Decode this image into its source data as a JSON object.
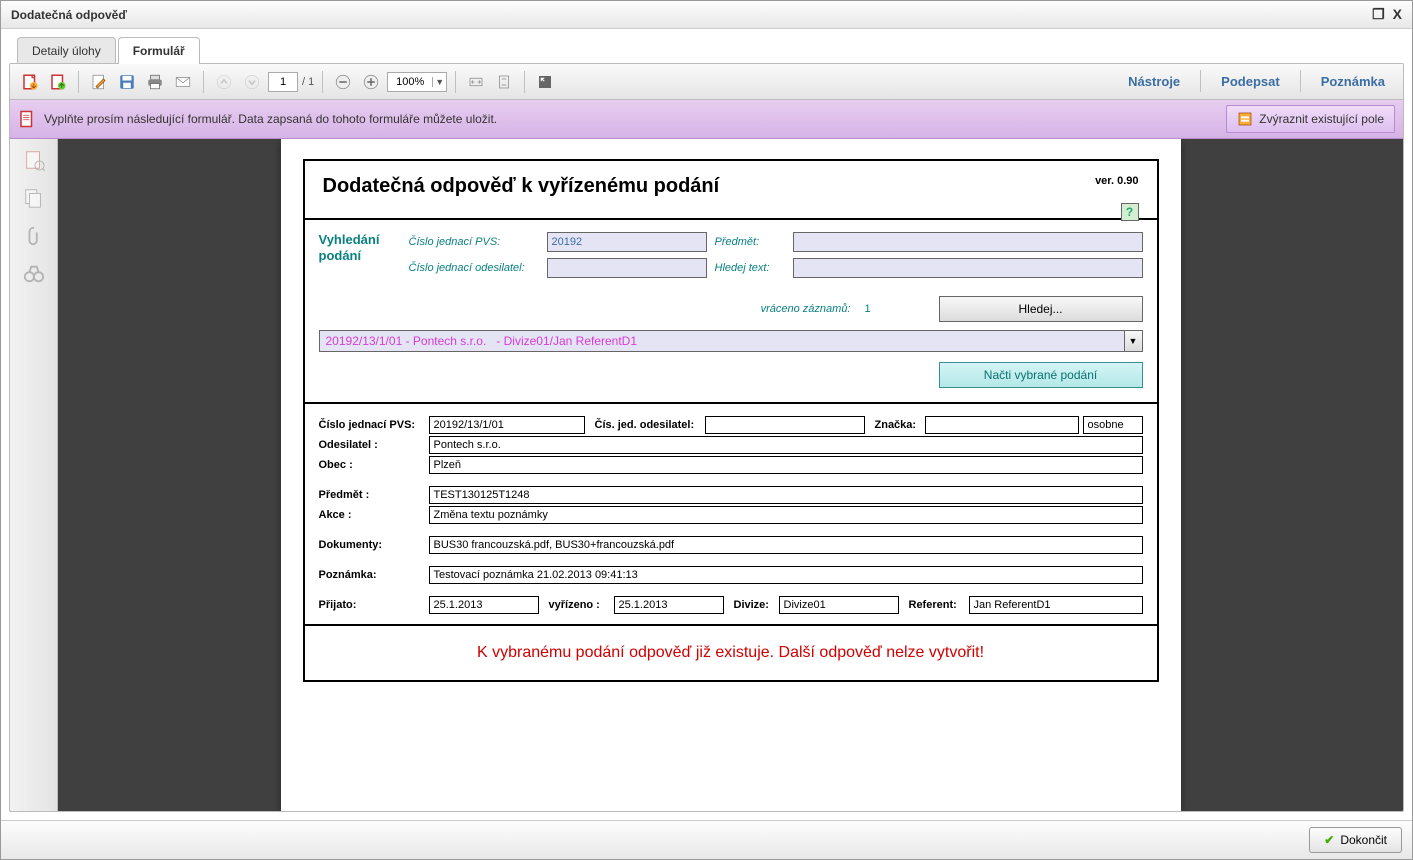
{
  "window": {
    "title": "Dodatečná odpověď"
  },
  "tabs": {
    "detail": "Detaily úlohy",
    "form": "Formulář"
  },
  "toolbar": {
    "page_current": "1",
    "page_total": "/ 1",
    "zoom": "100%",
    "links": {
      "tools": "Nástroje",
      "sign": "Podepsat",
      "note": "Poznámka"
    }
  },
  "infobar": {
    "text": "Vyplňte prosím následující formulář. Data zapsaná do tohoto formuláře můžete uložit.",
    "highlight": "Zvýraznit existující pole"
  },
  "form": {
    "title": "Dodatečná odpověď k vyřízenému podání",
    "version": "ver. 0.90",
    "help": "?",
    "search": {
      "heading": "Vyhledání podání",
      "pvs_label": "Číslo jednací PVS:",
      "pvs_value": "20192",
      "sender_label": "Číslo jednací odesilatel:",
      "sender_value": "",
      "subject_label": "Předmět:",
      "subject_value": "",
      "text_label": "Hledej text:",
      "text_value": "",
      "returned_label": "vráceno záznamů:",
      "returned_value": "1",
      "search_btn": "Hledej...",
      "result": "20192/13/1/01 - Pontech s.r.o.   - Divize01/Jan ReferentD1",
      "load_btn": "Načti vybrané podání"
    },
    "detail": {
      "cj_pvs_label": "Číslo jednací PVS:",
      "cj_pvs": "20192/13/1/01",
      "cj_od_label": "Čís. jed. odesilatel:",
      "cj_od": "",
      "znacka_label": "Značka:",
      "znacka": "",
      "osobne": "osobne",
      "odesilatel_label": "Odesilatel :",
      "odesilatel": "Pontech s.r.o.",
      "obec_label": "Obec :",
      "obec": "Plzeň",
      "predmet_label": "Předmět :",
      "predmet": "TEST130125T1248",
      "akce_label": "Akce :",
      "akce": "Změna textu poznámky",
      "dokumenty_label": "Dokumenty:",
      "dokumenty": "BUS30 francouzská.pdf, BUS30+francouzská.pdf",
      "poznamka_label": "Poznámka:",
      "poznamka": "Testovací poznámka 21.02.2013 09:41:13",
      "prijato_label": "Přijato:",
      "prijato": "25.1.2013",
      "vyrizeno_label": "vyřízeno :",
      "vyrizeno": "25.1.2013",
      "divize_label": "Divize:",
      "divize": "Divize01",
      "referent_label": "Referent:",
      "referent": "Jan ReferentD1"
    },
    "warning": "K vybranému podání odpověď již existuje. Další odpověď nelze vytvořit!"
  },
  "footer": {
    "finish": "Dokončit"
  }
}
